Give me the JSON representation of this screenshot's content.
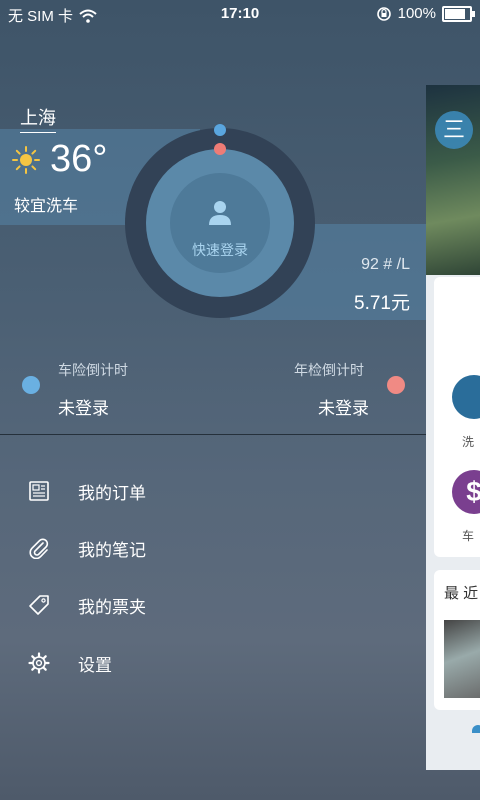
{
  "status_bar": {
    "carrier": "无 SIM 卡",
    "time": "17:10",
    "battery": "100%",
    "battery_level": 1.0,
    "icons": [
      "wifi-icon",
      "rotation-lock-icon",
      "battery-icon"
    ]
  },
  "weather": {
    "city": "上海",
    "temperature": "36°",
    "car_wash_advice": "较宜洗车",
    "icon": "sun-icon"
  },
  "login": {
    "label": "快速登录",
    "icon": "user-icon"
  },
  "fuel": {
    "type": "92 # /L",
    "price": "5.71元"
  },
  "countdowns": {
    "insurance": {
      "label": "车险倒计时",
      "value": "未登录"
    },
    "annual_inspection": {
      "label": "年检倒计时",
      "value": "未登录"
    }
  },
  "menu": [
    {
      "label": "我的订单",
      "icon": "order-icon"
    },
    {
      "label": "我的笔记",
      "icon": "paperclip-icon"
    },
    {
      "label": "我的票夹",
      "icon": "ticket-tag-icon"
    },
    {
      "label": "设置",
      "icon": "gear-icon"
    }
  ],
  "peek_panel": {
    "menu_glyph": "三",
    "service_wash_label": "洗",
    "service_car_label": "车",
    "recent_title": "最 近"
  },
  "colors": {
    "accent_blue": "#5aa6df",
    "accent_red": "#ee7c76",
    "ring_dark": "#324256",
    "ring_light": "#5b89a9"
  }
}
